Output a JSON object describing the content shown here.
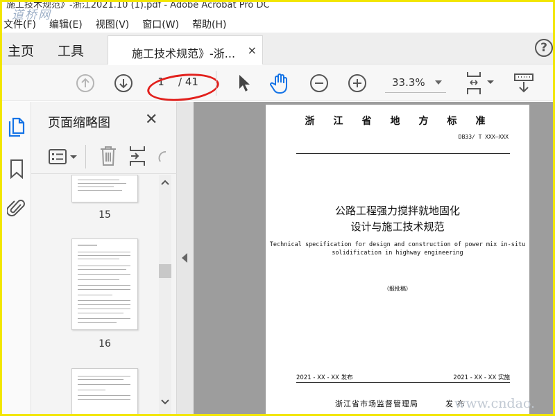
{
  "window": {
    "title": "施工技术规范》-浙江2021.10 (1).pdf - Adobe Acrobat Pro DC"
  },
  "watermarks": {
    "top": "道桥网",
    "bottom": "www.cndao."
  },
  "menubar": {
    "items": [
      "文件(F)",
      "编辑(E)",
      "视图(V)",
      "窗口(W)",
      "帮助(H)"
    ]
  },
  "tabs": {
    "home": "主页",
    "tools": "工具",
    "document": "施工技术规范》-浙...",
    "close_glyph": "×",
    "help_glyph": "?"
  },
  "toolbar": {
    "page_current": "1",
    "page_total": "/ 41",
    "zoom": "33.3%",
    "icons": [
      "arrow-up-circle-icon",
      "arrow-down-circle-icon",
      "cursor-arrow-icon",
      "hand-tool-icon",
      "zoom-out-icon",
      "zoom-in-icon",
      "fit-page-icon",
      "keyboard-scroll-icon"
    ]
  },
  "left_rail": {
    "icons": [
      "page-thumbnails-icon",
      "bookmark-icon",
      "attachment-icon"
    ]
  },
  "thumbnails_panel": {
    "title": "页面缩略图",
    "close_glyph": "✕",
    "tool_icons": [
      "options-menu-icon",
      "delete-icon",
      "insert-pages-icon",
      "rotate-icon"
    ],
    "pages": [
      {
        "label": "15"
      },
      {
        "label": "16"
      },
      {
        "label": ""
      }
    ]
  },
  "document_page": {
    "standard_type": "浙江省地方标准",
    "code": "DB33/ T XXX—XXX",
    "title_line_1": "公路工程强力搅拌就地固化",
    "title_line_2": "设计与施工技术规范",
    "english_title_line_1": "Technical specification for design and construction of power mix in-situ",
    "english_title_line_2": "solidification in highway engineering",
    "draft_label": "（报批稿）",
    "issue_date": "2021 - XX - XX 发布",
    "implementation_date": "2021 - XX - XX 实施",
    "issuer": "浙江省市场监督管理局",
    "issue_word": "发布"
  },
  "colors": {
    "frame_border": "#f2e600",
    "annotation_ellipse": "#e2201c",
    "active_tool": "#1473e6",
    "doc_background": "#9d9d9d"
  }
}
